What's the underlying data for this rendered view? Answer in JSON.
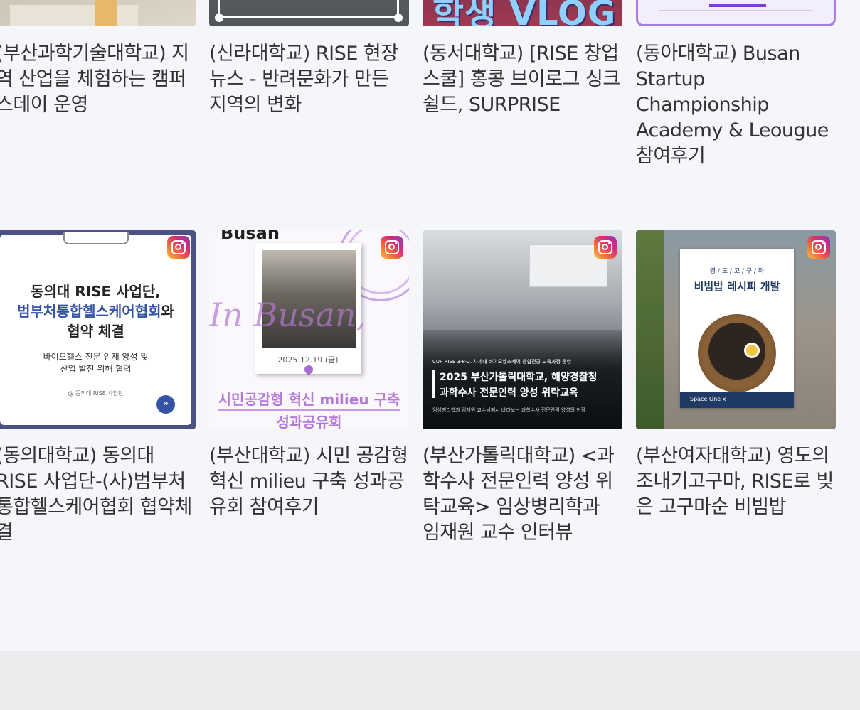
{
  "posts_row1": [
    {
      "title": "(부산과학기술대학교) 지역 산업을 체험하는 캠퍼스데이 운영"
    },
    {
      "title": "(신라대학교) RISE 현장뉴스 - 반려문화가 만든 지역의 변화"
    },
    {
      "title": "(동서대학교) [RISE 창업스쿨] 홍콩 브이로그 싱크쉴드, SURPRISE",
      "thumb_text": "학생 VLOG"
    },
    {
      "title": "(동아대학교) Busan Startup Championship Academy & Leougue 참여후기"
    }
  ],
  "posts_row2": [
    {
      "title": "(동의대학교) 동의대 RISE 사업단-(사)범부처통합헬스케어협회 협약체결",
      "thumb": {
        "headline_1": "동의대 RISE 사업단,",
        "headline_2a": "범부처통합헬스케어협회",
        "headline_2b": "와",
        "headline_3": "협약 체결",
        "sub_1": "바이오헬스 전문 인재 양성 및",
        "sub_2": "산업 발전 위해 협력",
        "org": "@ 동의대 RISE 사업단",
        "next": "»"
      }
    },
    {
      "title": "(부산대학교) 시민 공감형 혁신 milieu 구축 성과공유회 참여후기",
      "thumb": {
        "top_text": "Busan",
        "script": "In Busan,",
        "date": "2025.12.19.(금)",
        "caption_1": "시민공감형 혁신 milieu 구축",
        "caption_2": "성과공유회"
      }
    },
    {
      "title": "(부산가톨릭대학교) <과학수사 전문인력 양성 위탁교육> 임상병리학과 임재원 교수 인터뷰",
      "thumb": {
        "small_top": "CUP RISE 3-8-2. 차세대 바이오헬스케어 융합전공 교육과정 운영",
        "headline_1": "2025 부산가톨릭대학교, 해양경찰청",
        "headline_2": "과학수사 전문인력 양성 위탁교육",
        "small_bottom": "임상병리학과 임재원 교수님께서 바라보는 과학수사 전문인력 양성의 현장"
      }
    },
    {
      "title": "(부산여자대학교) 영도의 조내기고구마, RISE로 빚은 고구마순 비빔밥",
      "thumb": {
        "poster_small": "영 / 도 / 고 / 구 / 마",
        "poster_title": "비빔밥 레시피 개발",
        "poster_footer": "Space One x"
      }
    }
  ],
  "colors": {
    "background": "#f5f6fa",
    "title_text": "#333333",
    "footer": "#ececef",
    "accent_purple": "#9b5fd0",
    "dongeui_blue": "#3453a3"
  }
}
